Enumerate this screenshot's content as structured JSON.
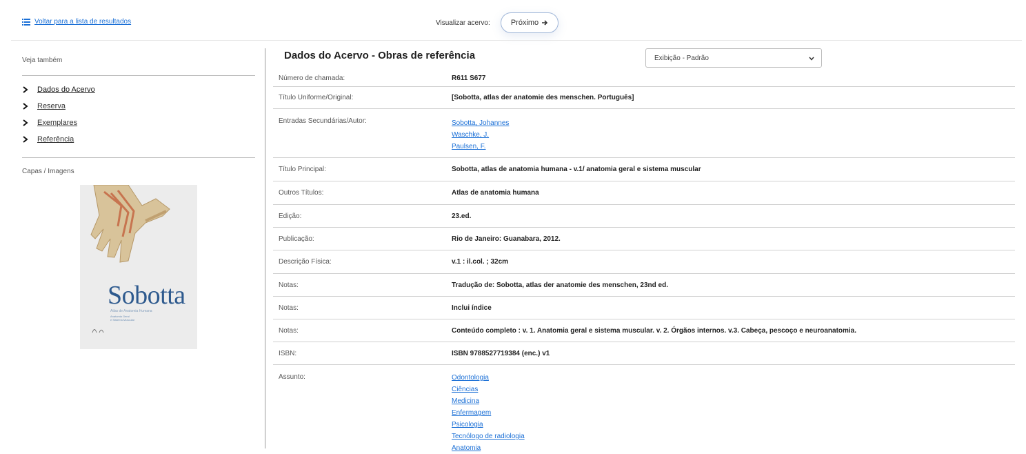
{
  "topbar": {
    "back_label": "Voltar para a lista de resultados",
    "visualizar_label": "Visualizar acervo:",
    "next_label": "Próximo"
  },
  "sidebar": {
    "heading": "Veja também",
    "items": [
      {
        "label": "Dados do Acervo"
      },
      {
        "label": "Reserva"
      },
      {
        "label": "Exemplares"
      },
      {
        "label": "Referência"
      }
    ],
    "capas_heading": "Capas / Imagens",
    "cover": {
      "title": "Sobotta",
      "subtitle": "Atlas de Anatomia Humana",
      "volume_text": "Anatomia Geral\ne Sistema Muscular"
    }
  },
  "main": {
    "title": "Dados do Acervo - Obras de referência",
    "display_select": "Exibição - Padrão",
    "rows": [
      {
        "label": "Número de chamada:",
        "value": "R611  S677"
      },
      {
        "label": "Título Uniforme/Original:",
        "value": "[Sobotta, atlas der anatomie des menschen.  Português]"
      },
      {
        "label": "Entradas Secundárias/Autor:",
        "links": [
          "Sobotta, Johannes",
          "Waschke, J.",
          "Paulsen, F."
        ]
      },
      {
        "label": "Título Principal:",
        "value": "Sobotta, atlas de anatomia humana - v.1/  anatomia geral e sistema muscular"
      },
      {
        "label": "Outros Títulos:",
        "value": "Atlas de anatomia humana"
      },
      {
        "label": "Edição:",
        "value": "23.ed."
      },
      {
        "label": "Publicação:",
        "value": "Rio de Janeiro:  Guanabara,  2012."
      },
      {
        "label": "Descrição Física:",
        "value": "v.1 :  il.col. ;  32cm"
      },
      {
        "label": "Notas:",
        "value": "Tradução de: Sobotta, atlas der anatomie des menschen, 23nd ed."
      },
      {
        "label": "Notas:",
        "value": "Inclui índice"
      },
      {
        "label": "Notas:",
        "value": "Conteúdo completo : v. 1. Anatomia geral e sistema muscular. v. 2. Órgãos internos. v.3. Cabeça, pescoço e neuroanatomia."
      },
      {
        "label": "ISBN:",
        "value": "ISBN 9788527719384 (enc.) v1"
      },
      {
        "label": "Assunto:",
        "links": [
          "Odontologia",
          "Ciências",
          "Medicina",
          "Enfermagem",
          "Psicologia",
          "Tecnólogo de radiologia",
          "Anatomia"
        ]
      }
    ]
  }
}
